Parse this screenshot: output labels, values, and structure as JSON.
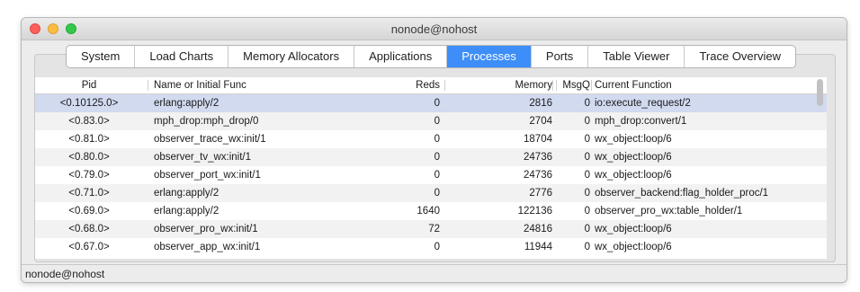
{
  "window": {
    "title": "nonode@nohost"
  },
  "tabs": [
    "System",
    "Load Charts",
    "Memory Allocators",
    "Applications",
    "Processes",
    "Ports",
    "Table Viewer",
    "Trace Overview"
  ],
  "active_tab": "Processes",
  "columns": {
    "pid": "Pid",
    "name": "Name or Initial Func",
    "reds": "Reds",
    "memory": "Memory",
    "msgq": "MsgQ",
    "func": "Current Function"
  },
  "rows": [
    {
      "pid": "<0.10125.0>",
      "name": "erlang:apply/2",
      "reds": "0",
      "memory": "2816",
      "msgq": "0",
      "func": "io:execute_request/2",
      "selected": true
    },
    {
      "pid": "<0.83.0>",
      "name": "mph_drop:mph_drop/0",
      "reds": "0",
      "memory": "2704",
      "msgq": "0",
      "func": "mph_drop:convert/1"
    },
    {
      "pid": "<0.81.0>",
      "name": "observer_trace_wx:init/1",
      "reds": "0",
      "memory": "18704",
      "msgq": "0",
      "func": "wx_object:loop/6"
    },
    {
      "pid": "<0.80.0>",
      "name": "observer_tv_wx:init/1",
      "reds": "0",
      "memory": "24736",
      "msgq": "0",
      "func": "wx_object:loop/6"
    },
    {
      "pid": "<0.79.0>",
      "name": "observer_port_wx:init/1",
      "reds": "0",
      "memory": "24736",
      "msgq": "0",
      "func": "wx_object:loop/6"
    },
    {
      "pid": "<0.71.0>",
      "name": "erlang:apply/2",
      "reds": "0",
      "memory": "2776",
      "msgq": "0",
      "func": "observer_backend:flag_holder_proc/1"
    },
    {
      "pid": "<0.69.0>",
      "name": "erlang:apply/2",
      "reds": "1640",
      "memory": "122136",
      "msgq": "0",
      "func": "observer_pro_wx:table_holder/1"
    },
    {
      "pid": "<0.68.0>",
      "name": "observer_pro_wx:init/1",
      "reds": "72",
      "memory": "24816",
      "msgq": "0",
      "func": "wx_object:loop/6"
    },
    {
      "pid": "<0.67.0>",
      "name": "observer_app_wx:init/1",
      "reds": "0",
      "memory": "11944",
      "msgq": "0",
      "func": "wx_object:loop/6"
    }
  ],
  "status": "nonode@nohost"
}
